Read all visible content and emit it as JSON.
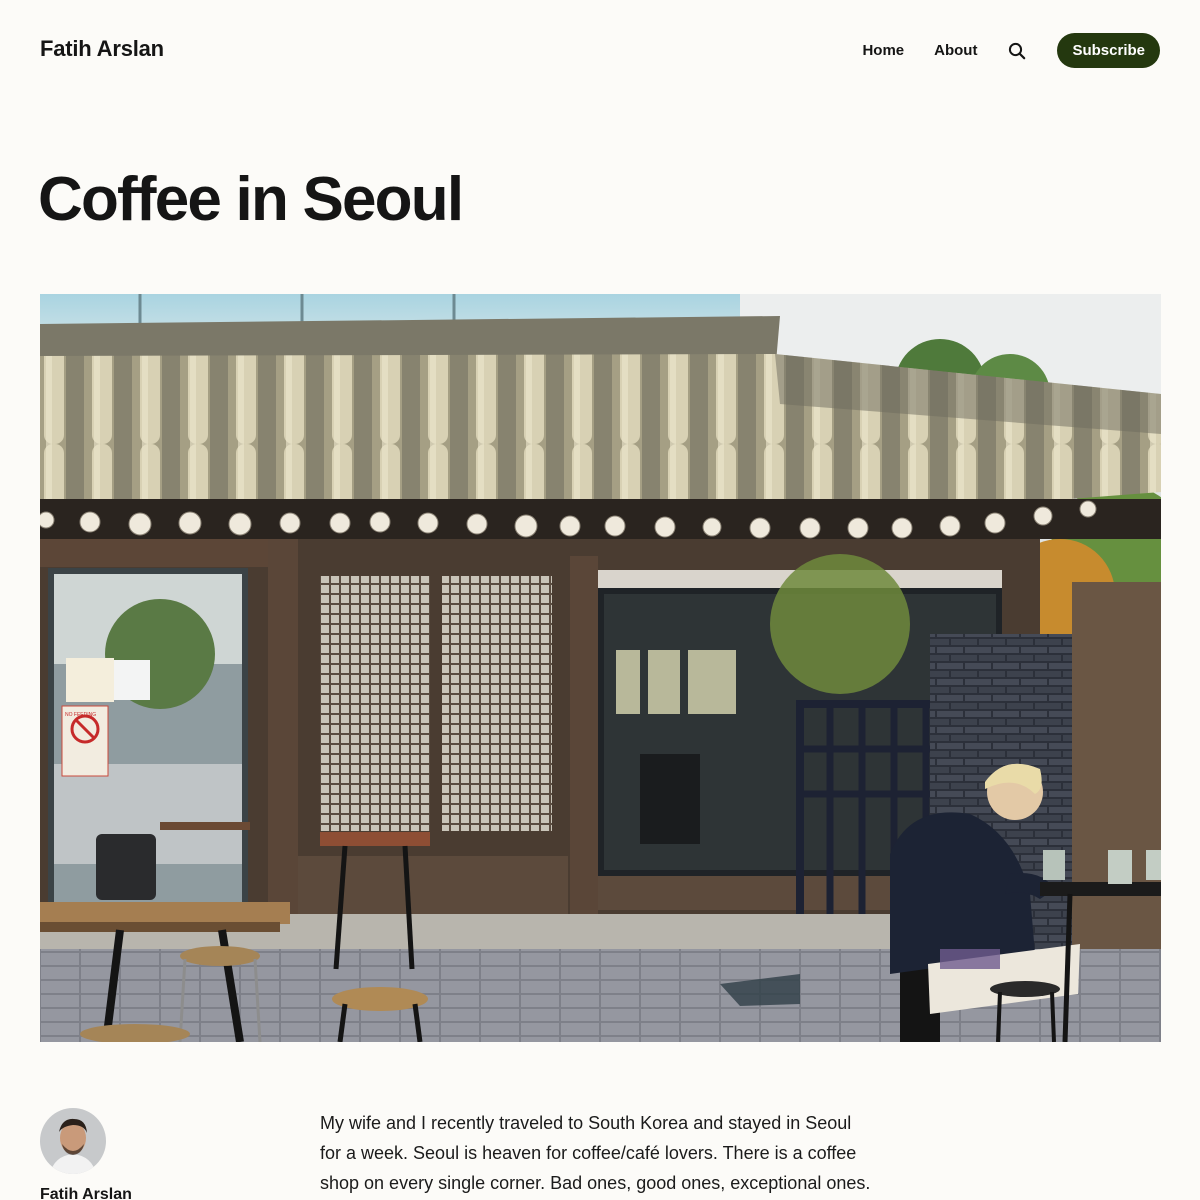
{
  "header": {
    "site_title": "Fatih Arslan",
    "nav": [
      {
        "label": "Home"
      },
      {
        "label": "About"
      }
    ],
    "search_icon": "search-icon",
    "subscribe_label": "Subscribe",
    "accent_color": "#24380f"
  },
  "post": {
    "title": "Coffee in Seoul",
    "hero_image": "photo of a traditional Korean hanok café with tiled roof",
    "hero_signs": {
      "no_feeding": "NO FEEDING"
    },
    "author": {
      "name": "Fatih Arslan",
      "avatar": "author-avatar"
    },
    "body_lines": [
      "My wife and I recently traveled to South Korea and stayed in Seoul",
      "for a week. Seoul is heaven for coffee/café lovers. There is a coffee",
      "shop on every single corner. Bad ones, good ones, exceptional ones."
    ]
  }
}
